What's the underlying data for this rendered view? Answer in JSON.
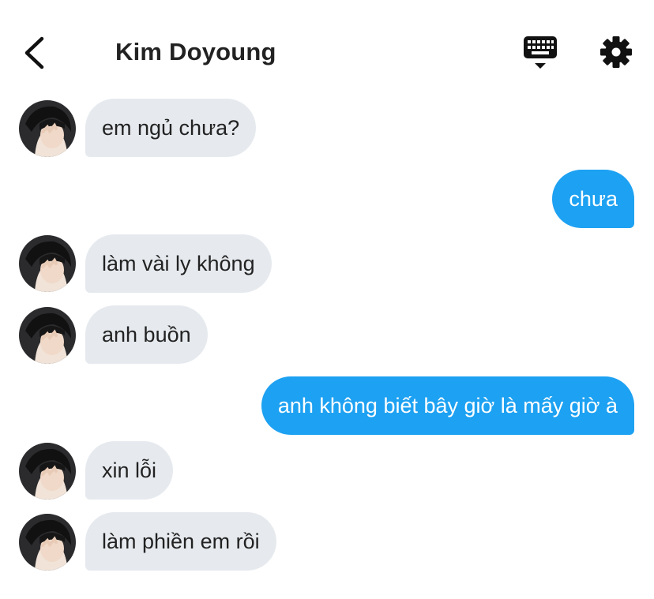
{
  "header": {
    "title": "Kim Doyoung",
    "back_icon": "chevron-left-icon",
    "keyboard_icon": "keyboard-icon",
    "settings_icon": "gear-icon"
  },
  "colors": {
    "incoming_bubble": "#e6eaee",
    "outgoing_bubble": "#1da1f2",
    "text": "#222222"
  },
  "messages": [
    {
      "sender": "Kim Doyoung",
      "direction": "incoming",
      "text": "em ngủ chưa?"
    },
    {
      "sender": "me",
      "direction": "outgoing",
      "text": "chưa"
    },
    {
      "sender": "Kim Doyoung",
      "direction": "incoming",
      "text": "làm vài ly không"
    },
    {
      "sender": "Kim Doyoung",
      "direction": "incoming",
      "text": "anh buồn"
    },
    {
      "sender": "me",
      "direction": "outgoing",
      "text": "anh không biết bây giờ là mấy giờ à"
    },
    {
      "sender": "Kim Doyoung",
      "direction": "incoming",
      "text": "xin lỗi"
    },
    {
      "sender": "Kim Doyoung",
      "direction": "incoming",
      "text": "làm phiền em rồi"
    }
  ]
}
